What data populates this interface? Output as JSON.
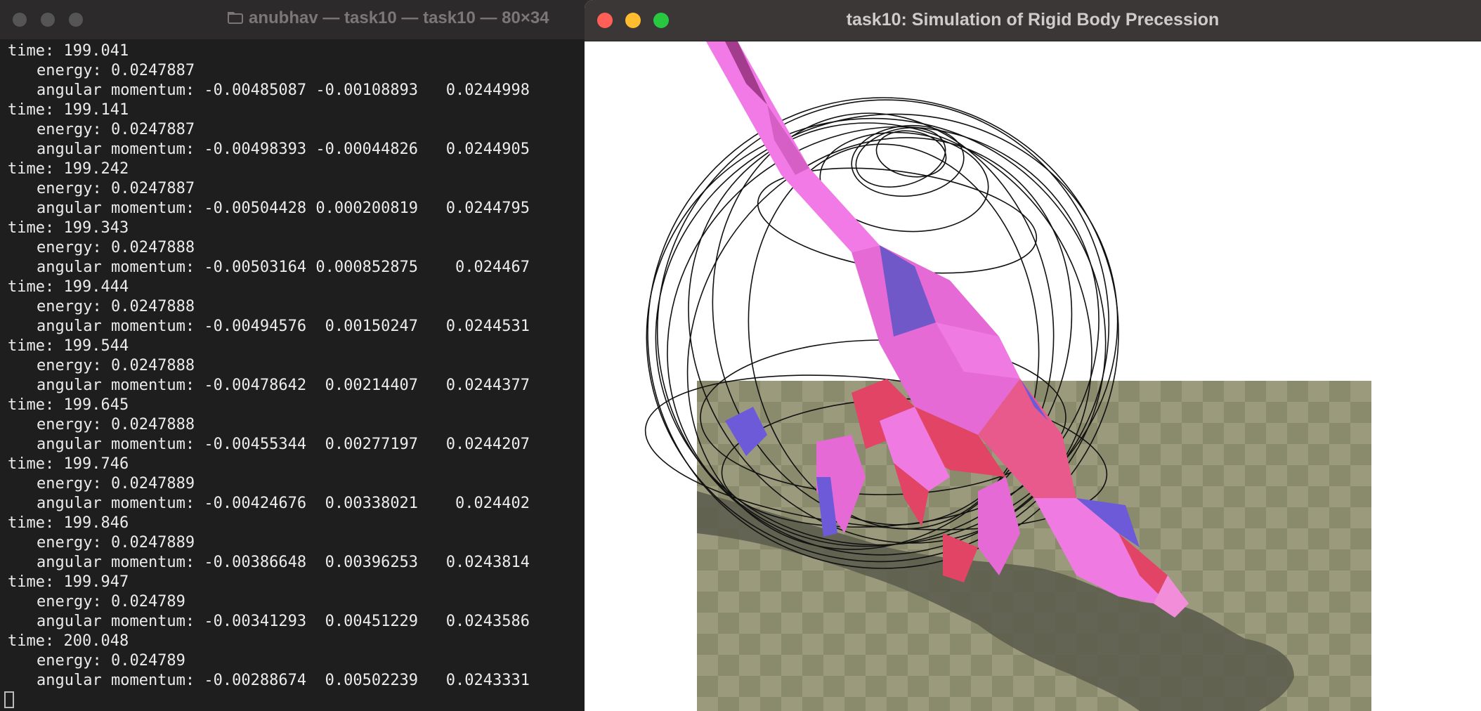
{
  "terminal": {
    "title": "anubhav — task10 — task10 — 80×34",
    "entries": [
      {
        "time": "time: 199.041",
        "energy": "energy: 0.0247887",
        "momentum": "angular momentum: -0.00485087 -0.00108893   0.0244998"
      },
      {
        "time": "time: 199.141",
        "energy": "energy: 0.0247887",
        "momentum": "angular momentum: -0.00498393 -0.00044826   0.0244905"
      },
      {
        "time": "time: 199.242",
        "energy": "energy: 0.0247887",
        "momentum": "angular momentum: -0.00504428 0.000200819   0.0244795"
      },
      {
        "time": "time: 199.343",
        "energy": "energy: 0.0247888",
        "momentum": "angular momentum: -0.00503164 0.000852875    0.024467"
      },
      {
        "time": "time: 199.444",
        "energy": "energy: 0.0247888",
        "momentum": "angular momentum: -0.00494576  0.00150247   0.0244531"
      },
      {
        "time": "time: 199.544",
        "energy": "energy: 0.0247888",
        "momentum": "angular momentum: -0.00478642  0.00214407   0.0244377"
      },
      {
        "time": "time: 199.645",
        "energy": "energy: 0.0247888",
        "momentum": "angular momentum: -0.00455344  0.00277197   0.0244207"
      },
      {
        "time": "time: 199.746",
        "energy": "energy: 0.0247889",
        "momentum": "angular momentum: -0.00424676  0.00338021    0.024402"
      },
      {
        "time": "time: 199.846",
        "energy": "energy: 0.0247889",
        "momentum": "angular momentum: -0.00386648  0.00396253   0.0243814"
      },
      {
        "time": "time: 199.947",
        "energy": "energy: 0.024789",
        "momentum": "angular momentum: -0.00341293  0.00451229   0.0243586"
      },
      {
        "time": "time: 200.048",
        "energy": "energy: 0.024789",
        "momentum": "angular momentum: -0.00288674  0.00502239   0.0243331"
      }
    ]
  },
  "app": {
    "title": "task10: Simulation of Rigid Body Precession",
    "colors": {
      "ground_light": "#9b9a7d",
      "ground_dark": "#8a8a6c",
      "shadow": "#5a5a4c",
      "body_pink": "#f27ae6",
      "body_red": "#e24466",
      "body_blue": "#6c5ad8",
      "wire": "#111111"
    }
  },
  "traffic_lights": {
    "close": "#ff5f57",
    "minimize": "#febc2e",
    "zoom": "#28c840"
  }
}
